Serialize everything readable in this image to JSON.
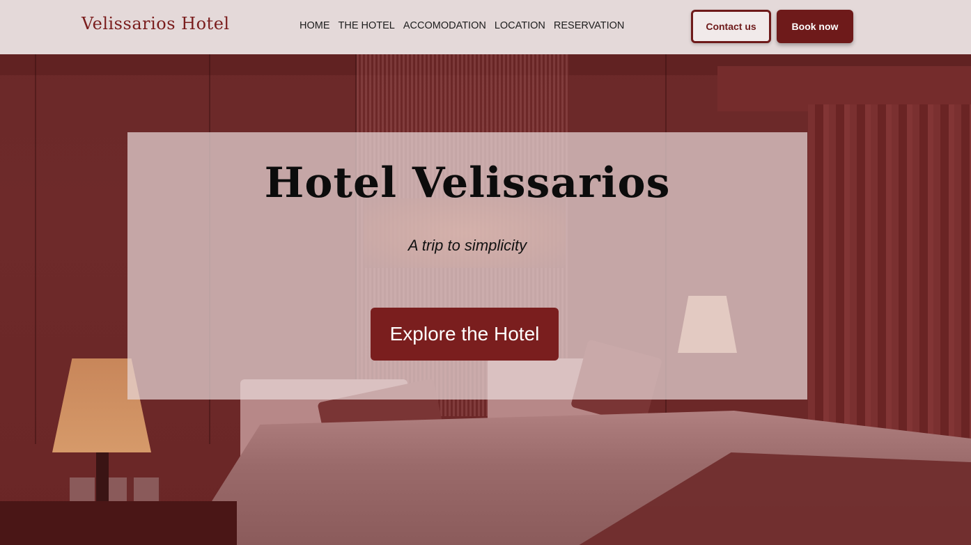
{
  "header": {
    "brand": "Velissarios Hotel",
    "nav": [
      "HOME",
      "THE HOTEL",
      "ACCOMODATION",
      "LOCATION",
      "RESERVATION"
    ],
    "contact_label": "Contact us",
    "book_label": "Book now"
  },
  "hero": {
    "title": "Hotel Velissarios",
    "tagline": "A trip to simplicity",
    "cta_label": "Explore the Hotel"
  },
  "colors": {
    "accent": "#6e1a1a",
    "header_bg": "#e4d9d9"
  }
}
